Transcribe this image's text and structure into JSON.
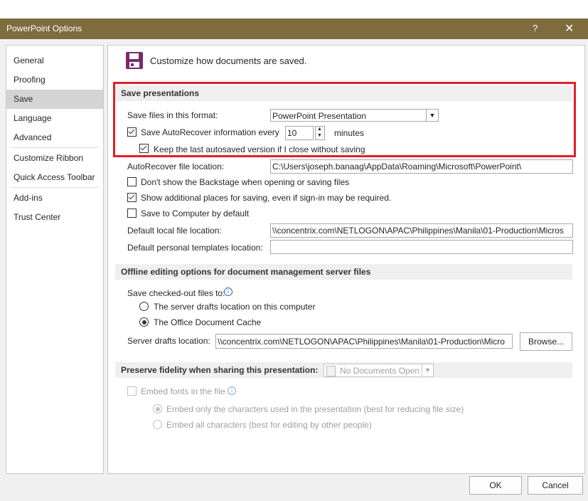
{
  "window": {
    "title": "PowerPoint Options",
    "help_glyph": "?",
    "close_glyph": "✕"
  },
  "nav": {
    "items": [
      {
        "label": "General"
      },
      {
        "label": "Proofing"
      },
      {
        "label": "Save",
        "selected": true
      },
      {
        "label": "Language"
      },
      {
        "label": "Advanced"
      },
      {
        "label": "Customize Ribbon"
      },
      {
        "label": "Quick Access Toolbar"
      },
      {
        "label": "Add-ins"
      },
      {
        "label": "Trust Center"
      }
    ]
  },
  "page": {
    "icon": "save-disk-icon",
    "heading": "Customize how documents are saved."
  },
  "save_presentations": {
    "header": "Save presentations",
    "format_label": "Save files in this format:",
    "format_value": "PowerPoint Presentation",
    "autorecover_label": "Save AutoRecover information every",
    "autorecover_checked": true,
    "autorecover_minutes": "10",
    "minutes_label": "minutes",
    "keep_last_label": "Keep the last autosaved version if I close without saving",
    "keep_last_checked": true,
    "autorecover_location_label": "AutoRecover file location:",
    "autorecover_location_value": "C:\\Users\\joseph.banaag\\AppData\\Roaming\\Microsoft\\PowerPoint\\",
    "backstage_label": "Don't show the Backstage when opening or saving files",
    "backstage_checked": false,
    "additional_places_label": "Show additional places for saving, even if sign-in may be required.",
    "additional_places_checked": true,
    "save_to_computer_label": "Save to Computer by default",
    "save_to_computer_checked": false,
    "default_local_label": "Default local file location:",
    "default_local_value": "\\\\concentrix.com\\NETLOGON\\APAC\\Philippines\\Manila\\01-Production\\Micros",
    "default_templates_label": "Default personal templates location:",
    "default_templates_value": "",
    "highlight_color": "#e3202a"
  },
  "offline": {
    "header": "Offline editing options for document management server files",
    "checked_out_label": "Save checked-out files to:",
    "server_drafts_option": "The server drafts location on this computer",
    "office_cache_option": "The Office Document Cache",
    "selected": "office_cache",
    "server_drafts_label": "Server drafts location:",
    "server_drafts_value": "\\\\concentrix.com\\NETLOGON\\APAC\\Philippines\\Manila\\01-Production\\Micro",
    "browse_label": "Browse..."
  },
  "fidelity": {
    "header": "Preserve fidelity when sharing this presentation:",
    "document_value": "No Documents Open",
    "embed_fonts_label": "Embed fonts in the file",
    "embed_only_label": "Embed only the characters used in the presentation (best for reducing file size)",
    "embed_all_label": "Embed all characters (best for editing by other people)"
  },
  "footer": {
    "ok_label": "OK",
    "cancel_label": "Cancel"
  },
  "colors": {
    "titlebar": "#7e6c3f",
    "save_icon": "#7b2a6e",
    "highlight": "#e3202a"
  }
}
